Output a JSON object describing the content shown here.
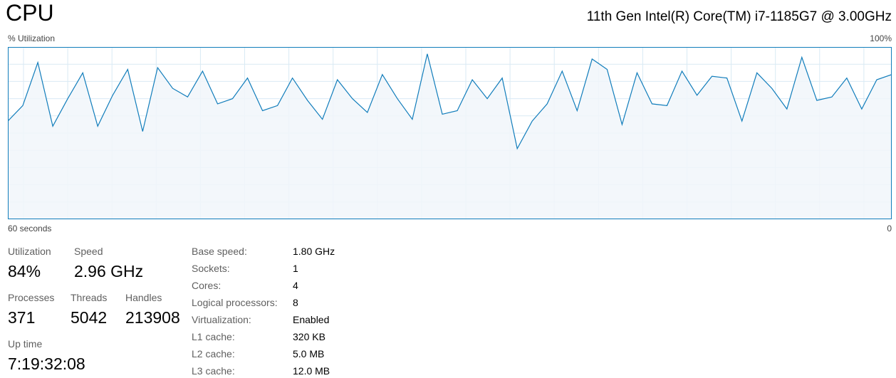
{
  "header": {
    "title": "CPU",
    "cpu_model": "11th Gen Intel(R) Core(TM) i7-1185G7 @ 3.00GHz"
  },
  "graph": {
    "y_label": "% Utilization",
    "y_max_label": "100%",
    "x_start_label": "60 seconds",
    "x_end_label": "0",
    "line_color": "#117dbb",
    "fill_color": "#f1f6fa",
    "grid_color": "#d9eaf4",
    "border_color": "#117dbb"
  },
  "chart_data": {
    "type": "area",
    "x": [
      60,
      59,
      58,
      57,
      56,
      55,
      54,
      53,
      52,
      51,
      50,
      49,
      48,
      47,
      46,
      45,
      44,
      43,
      42,
      41,
      40,
      39,
      38,
      37,
      36,
      35,
      34,
      33,
      32,
      31,
      30,
      29,
      28,
      27,
      26,
      25,
      24,
      23,
      22,
      21,
      20,
      19,
      18,
      17,
      16,
      15,
      14,
      13,
      12,
      11,
      10,
      9,
      8,
      7,
      6,
      5,
      4,
      3,
      2,
      1,
      0
    ],
    "values": [
      57,
      66,
      91,
      54,
      70,
      85,
      54,
      72,
      87,
      51,
      88,
      76,
      71,
      86,
      67,
      70,
      82,
      63,
      66,
      82,
      69,
      58,
      81,
      70,
      62,
      84,
      70,
      58,
      96,
      61,
      63,
      81,
      70,
      82,
      41,
      57,
      67,
      86,
      63,
      93,
      87,
      55,
      85,
      67,
      66,
      86,
      72,
      83,
      82,
      57,
      85,
      76,
      64,
      94,
      69,
      71,
      82,
      64,
      81,
      84
    ]
  },
  "stats": {
    "utilization": {
      "label": "Utilization",
      "value": "84%"
    },
    "speed": {
      "label": "Speed",
      "value": "2.96 GHz"
    },
    "processes": {
      "label": "Processes",
      "value": "371"
    },
    "threads": {
      "label": "Threads",
      "value": "5042"
    },
    "handles": {
      "label": "Handles",
      "value": "213908"
    },
    "uptime": {
      "label": "Up time",
      "value": "7:19:32:08"
    }
  },
  "details": [
    {
      "label": "Base speed:",
      "value": "1.80 GHz"
    },
    {
      "label": "Sockets:",
      "value": "1"
    },
    {
      "label": "Cores:",
      "value": "4"
    },
    {
      "label": "Logical processors:",
      "value": "8"
    },
    {
      "label": "Virtualization:",
      "value": "Enabled"
    },
    {
      "label": "L1 cache:",
      "value": "320 KB"
    },
    {
      "label": "L2 cache:",
      "value": "5.0 MB"
    },
    {
      "label": "L3 cache:",
      "value": "12.0 MB"
    }
  ]
}
